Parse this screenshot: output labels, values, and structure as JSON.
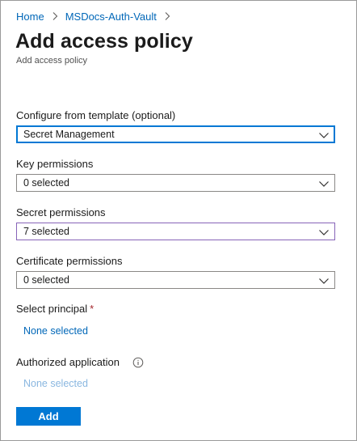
{
  "breadcrumb": {
    "items": [
      {
        "label": "Home"
      },
      {
        "label": "MSDocs-Auth-Vault"
      }
    ]
  },
  "header": {
    "title": "Add access policy",
    "subtitle": "Add access policy"
  },
  "form": {
    "template": {
      "label": "Configure from template (optional)",
      "value": "Secret Management"
    },
    "key_permissions": {
      "label": "Key permissions",
      "value": "0 selected"
    },
    "secret_permissions": {
      "label": "Secret permissions",
      "value": "7 selected"
    },
    "certificate_permissions": {
      "label": "Certificate permissions",
      "value": "0 selected"
    },
    "principal": {
      "label": "Select principal",
      "required_marker": "*",
      "link": "None selected"
    },
    "authorized_application": {
      "label": "Authorized application",
      "link": "None selected"
    }
  },
  "actions": {
    "add_label": "Add"
  },
  "icons": {
    "breadcrumb_separator": "chevron-right-icon",
    "dropdown": "chevron-down-icon",
    "info": "info-icon"
  },
  "colors": {
    "accent": "#0078d4",
    "link": "#0067b8",
    "required": "#a4262c",
    "hover_border": "#8764b8"
  }
}
